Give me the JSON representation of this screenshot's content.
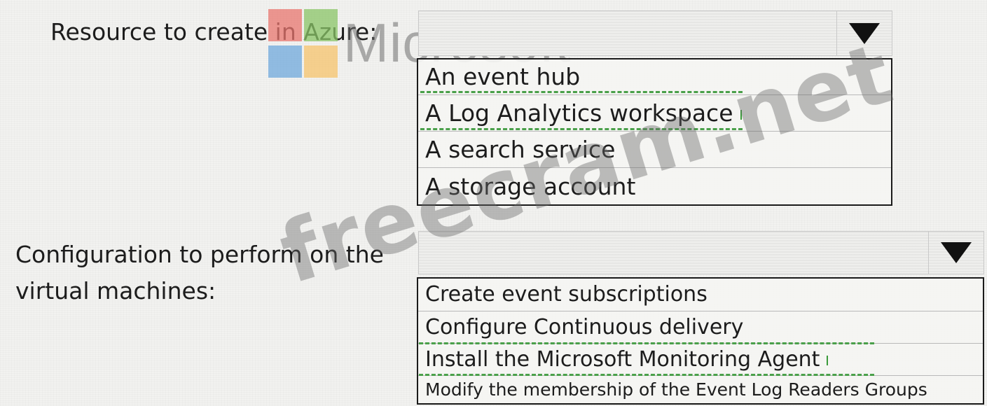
{
  "section1": {
    "label": "Resource to create in Azure:",
    "options": [
      "An event hub",
      "A Log Analytics workspace",
      "A search service",
      "A storage account"
    ],
    "answer_index": 1
  },
  "section2": {
    "label_line1": "Configuration to perform on the",
    "label_line2": "virtual machines:",
    "options": [
      "Create event subscriptions",
      "Configure Continuous delivery",
      "Install the Microsoft Monitoring Agent",
      "Modify the membership of the Event Log Readers Groups"
    ],
    "answer_index": 2
  },
  "watermark": {
    "brand": "Microsoft",
    "site": "freecram.net",
    "logo_colors": [
      "#e8766f",
      "#8ac467",
      "#6fa8dc",
      "#f6c36c"
    ]
  },
  "icons": {
    "dropdown": "dropdown-arrow-icon"
  }
}
